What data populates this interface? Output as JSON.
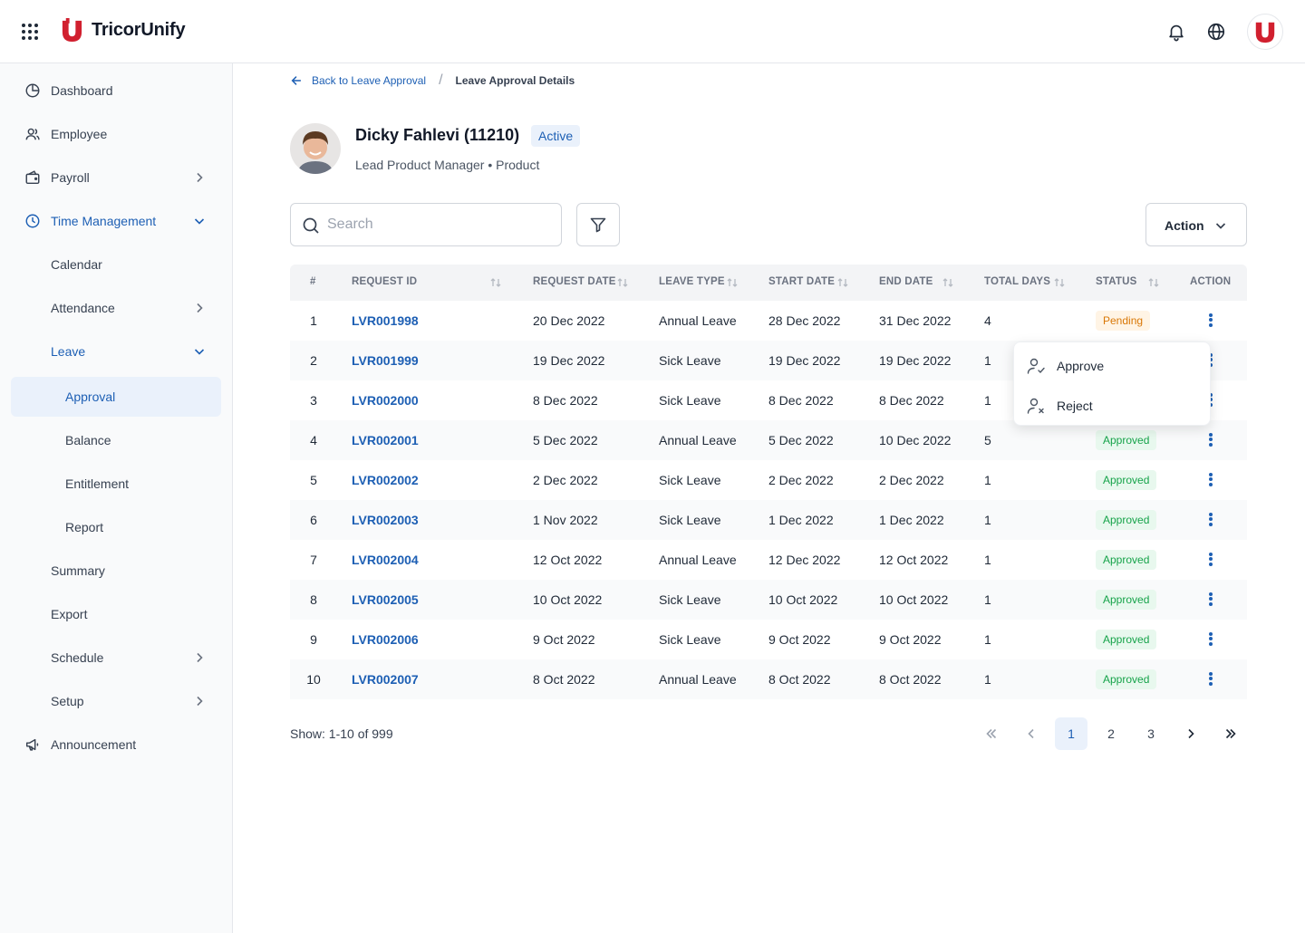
{
  "app": {
    "name": "TricorUnify"
  },
  "colors": {
    "accent": "#1d5fb4",
    "brand": "#d1202f",
    "pending": "#d97706",
    "approved": "#16a34a"
  },
  "topbar": {
    "icons": [
      "apps-grid-icon",
      "bell-icon",
      "globe-icon",
      "user-avatar"
    ]
  },
  "sidebar": {
    "items": [
      {
        "label": "Dashboard",
        "icon": "dashboard-icon"
      },
      {
        "label": "Employee",
        "icon": "employee-icon"
      },
      {
        "label": "Payroll",
        "icon": "wallet-icon"
      },
      {
        "label": "Time Management",
        "icon": "clock-icon"
      },
      {
        "label": "Calendar"
      },
      {
        "label": "Attendance"
      },
      {
        "label": "Leave"
      },
      {
        "label": "Approval"
      },
      {
        "label": "Balance"
      },
      {
        "label": "Entitlement"
      },
      {
        "label": "Report"
      },
      {
        "label": "Summary"
      },
      {
        "label": "Export"
      },
      {
        "label": "Schedule"
      },
      {
        "label": "Setup"
      },
      {
        "label": "Announcement",
        "icon": "megaphone-icon"
      }
    ]
  },
  "breadcrumb": {
    "back": "Back to Leave Approval",
    "current": "Leave Approval Details"
  },
  "profile": {
    "name": "Dicky Fahlevi (11210)",
    "status": "Active",
    "subtitle": "Lead Product Manager • Product"
  },
  "toolbar": {
    "search_placeholder": "Search",
    "action_label": "Action"
  },
  "table": {
    "columns": [
      "#",
      "REQUEST ID",
      "REQUEST DATE",
      "LEAVE TYPE",
      "START DATE",
      "END DATE",
      "TOTAL DAYS",
      "STATUS",
      "ACTION"
    ],
    "rows": [
      {
        "n": "1",
        "id": "LVR001998",
        "req": "20 Dec 2022",
        "type": "Annual Leave",
        "start": "28 Dec 2022",
        "end": "31 Dec 2022",
        "days": "4",
        "status": "Pending"
      },
      {
        "n": "2",
        "id": "LVR001999",
        "req": "19 Dec 2022",
        "type": "Sick Leave",
        "start": "19 Dec 2022",
        "end": "19 Dec 2022",
        "days": "1",
        "status": ""
      },
      {
        "n": "3",
        "id": "LVR002000",
        "req": "8 Dec 2022",
        "type": "Sick Leave",
        "start": "8 Dec 2022",
        "end": "8 Dec 2022",
        "days": "1",
        "status": ""
      },
      {
        "n": "4",
        "id": "LVR002001",
        "req": "5 Dec 2022",
        "type": "Annual Leave",
        "start": "5 Dec 2022",
        "end": "10 Dec 2022",
        "days": "5",
        "status": "Approved"
      },
      {
        "n": "5",
        "id": "LVR002002",
        "req": "2 Dec 2022",
        "type": "Sick Leave",
        "start": "2 Dec 2022",
        "end": "2 Dec 2022",
        "days": "1",
        "status": "Approved"
      },
      {
        "n": "6",
        "id": "LVR002003",
        "req": "1 Nov 2022",
        "type": "Sick Leave",
        "start": "1 Dec 2022",
        "end": "1 Dec 2022",
        "days": "1",
        "status": "Approved"
      },
      {
        "n": "7",
        "id": "LVR002004",
        "req": "12 Oct 2022",
        "type": "Annual Leave",
        "start": "12 Dec 2022",
        "end": "12 Oct 2022",
        "days": "1",
        "status": "Approved"
      },
      {
        "n": "8",
        "id": "LVR002005",
        "req": "10 Oct 2022",
        "type": "Sick Leave",
        "start": "10 Oct 2022",
        "end": "10 Oct 2022",
        "days": "1",
        "status": "Approved"
      },
      {
        "n": "9",
        "id": "LVR002006",
        "req": "9 Oct 2022",
        "type": "Sick Leave",
        "start": "9 Oct 2022",
        "end": "9 Oct 2022",
        "days": "1",
        "status": "Approved"
      },
      {
        "n": "10",
        "id": "LVR002007",
        "req": "8 Oct 2022",
        "type": "Annual Leave",
        "start": "8 Oct 2022",
        "end": "8 Oct 2022",
        "days": "1",
        "status": "Approved"
      }
    ]
  },
  "row_menu": {
    "approve": "Approve",
    "reject": "Reject"
  },
  "pagination": {
    "showing": "Show: 1-10 of 999",
    "pages": [
      "1",
      "2",
      "3"
    ],
    "current": "1"
  }
}
